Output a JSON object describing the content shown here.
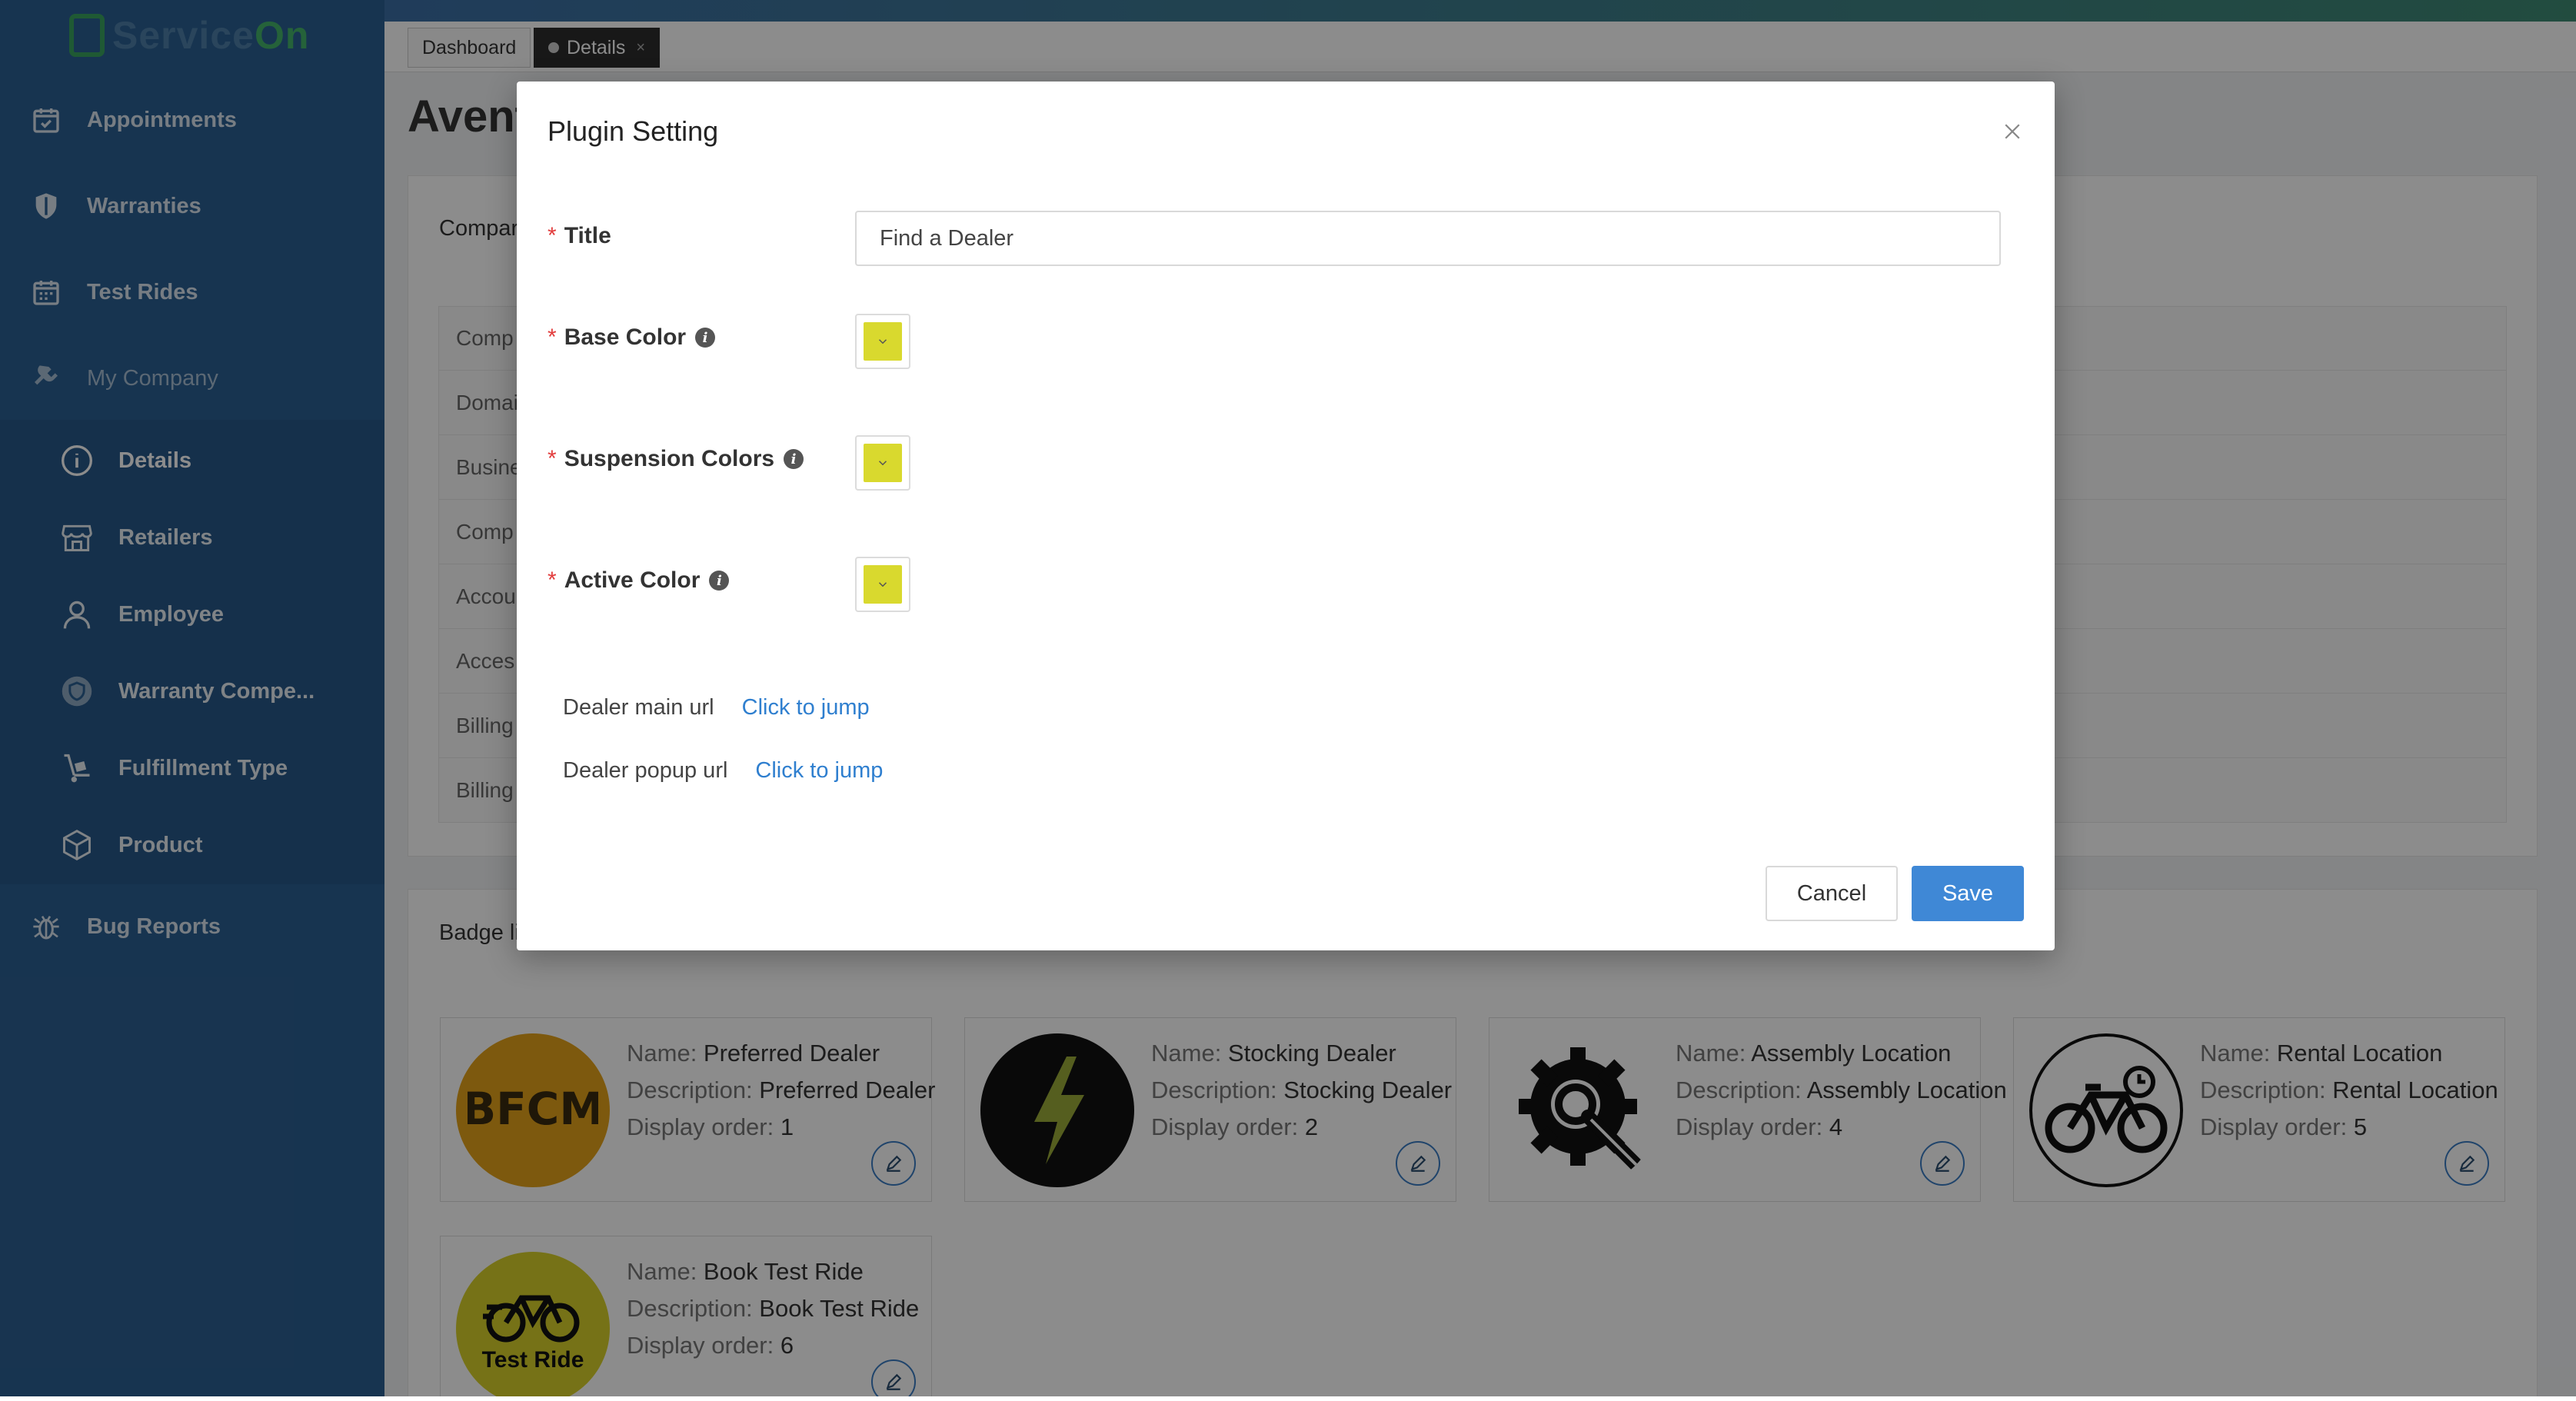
{
  "app": {
    "logo_text_a": "Service",
    "logo_text_b": "On"
  },
  "sidebar": {
    "items": [
      {
        "label": "Appointments",
        "icon": "calendar-check-icon"
      },
      {
        "label": "Warranties",
        "icon": "shield-icon"
      },
      {
        "label": "Test Rides",
        "icon": "calendar-grid-icon"
      },
      {
        "label": "My Company",
        "icon": "plug-icon"
      },
      {
        "label": "Bug Reports",
        "icon": "bug-icon"
      }
    ],
    "submenu": [
      {
        "label": "Details",
        "icon": "info-icon"
      },
      {
        "label": "Retailers",
        "icon": "store-icon"
      },
      {
        "label": "Employee",
        "icon": "user-icon"
      },
      {
        "label": "Warranty Compe...",
        "icon": "badge-shield-icon"
      },
      {
        "label": "Fulfillment Type",
        "icon": "hand-truck-icon"
      },
      {
        "label": "Product",
        "icon": "box-icon"
      }
    ]
  },
  "tabs": [
    {
      "label": "Dashboard"
    },
    {
      "label": "Details"
    }
  ],
  "page": {
    "title_partial": "Avent",
    "company_card_title": "Compar",
    "info_rows": [
      "Comp",
      "Domai",
      "Busine",
      "Comp",
      "Accou",
      "Acces",
      "Billing",
      "Billing"
    ],
    "badge_card_title": "Badge li"
  },
  "badges": [
    {
      "name": "Preferred Dealer",
      "description": "Preferred Dealer",
      "order": "1",
      "icon_text": "BFCM"
    },
    {
      "name": "Stocking Dealer",
      "description": "Stocking Dealer",
      "order": "2",
      "icon_text": ""
    },
    {
      "name": "Assembly Location",
      "description": "Assembly Location",
      "order": "4",
      "icon_text": ""
    },
    {
      "name": "Rental Location",
      "description": "Rental Location",
      "order": "5",
      "icon_text": ""
    },
    {
      "name": "Book Test Ride",
      "description": "Book Test Ride",
      "order": "6",
      "icon_text": "Test Ride"
    }
  ],
  "badge_labels": {
    "name": "Name: ",
    "description": "Description: ",
    "order": "Display order: "
  },
  "modal": {
    "title": "Plugin Setting",
    "required_mark": "*",
    "fields": {
      "title_label": "Title",
      "title_value": "Find a Dealer",
      "base_color_label": "Base Color",
      "suspension_colors_label": "Suspension Colors",
      "active_color_label": "Active Color"
    },
    "colors": {
      "base": "#d9d92e",
      "suspension": "#d9d92e",
      "active": "#d9d92e"
    },
    "urls": {
      "main_label": "Dealer main url",
      "main_link": "Click to jump",
      "popup_label": "Dealer popup url",
      "popup_link": "Click to jump"
    },
    "buttons": {
      "cancel": "Cancel",
      "save": "Save"
    }
  }
}
